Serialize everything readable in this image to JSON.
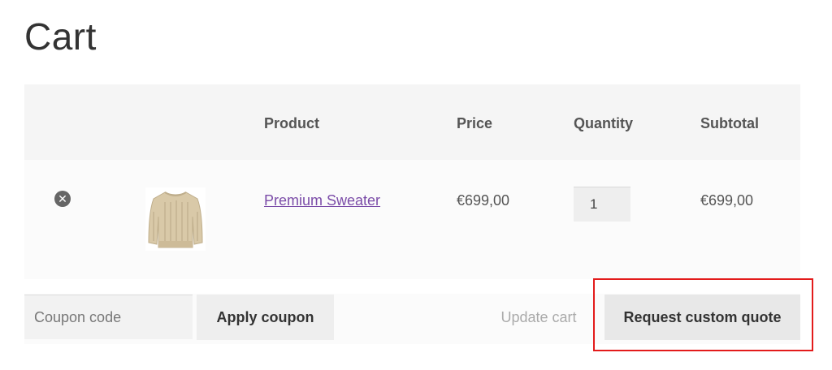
{
  "page": {
    "title": "Cart"
  },
  "table": {
    "headers": {
      "product": "Product",
      "price": "Price",
      "quantity": "Quantity",
      "subtotal": "Subtotal"
    },
    "rows": [
      {
        "remove_icon": "remove-circle-x-icon",
        "thumbnail": "sweater-image",
        "product": "Premium Sweater",
        "price": "€699,00",
        "quantity": "1",
        "subtotal": "€699,00"
      }
    ]
  },
  "actions": {
    "coupon_placeholder": "Coupon code",
    "apply_coupon": "Apply coupon",
    "update_cart": "Update cart",
    "request_quote": "Request custom quote"
  },
  "colors": {
    "link": "#7b4ca8",
    "highlight": "#e31b1b",
    "header_bg": "#f5f5f5"
  }
}
